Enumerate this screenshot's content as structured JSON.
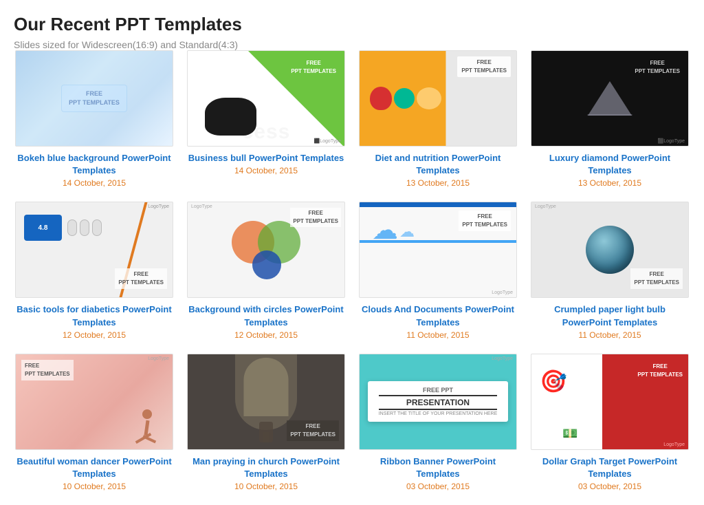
{
  "header": {
    "title": "Our Recent PPT Templates",
    "subtitle": "Slides sized for Widescreen(16:9) and Standard(4:3)"
  },
  "templates": [
    {
      "id": "bokeh-blue",
      "title": "Bokeh blue background PowerPoint Templates",
      "date": "14 October, 2015",
      "thumb_type": "bokeh",
      "badge": "FREE\nPPT TEMPLATES"
    },
    {
      "id": "business-bull",
      "title": "Business bull PowerPoint Templates",
      "date": "14 October, 2015",
      "thumb_type": "bull",
      "badge": "FREE\nPPT TEMPLATES"
    },
    {
      "id": "diet-nutrition",
      "title": "Diet and nutrition PowerPoint Templates",
      "date": "13 October, 2015",
      "thumb_type": "diet",
      "badge": "FREE\nPPT TEMPLATES"
    },
    {
      "id": "luxury-diamond",
      "title": "Luxury diamond PowerPoint Templates",
      "date": "13 October, 2015",
      "thumb_type": "diamond",
      "badge": "FREE\nPPT TEMPLATES"
    },
    {
      "id": "basic-tools-diabetics",
      "title": "Basic tools for diabetics PowerPoint Templates",
      "date": "12 October, 2015",
      "thumb_type": "diabetics",
      "badge": "FREE\nPPT TEMPLATES"
    },
    {
      "id": "background-circles",
      "title": "Background with circles PowerPoint Templates",
      "date": "12 October, 2015",
      "thumb_type": "circles",
      "badge": "FREE\nPPT TEMPLATES"
    },
    {
      "id": "clouds-documents",
      "title": "Clouds And Documents PowerPoint Templates",
      "date": "11 October, 2015",
      "thumb_type": "clouds",
      "badge": "FREE\nPPT TEMPLATES"
    },
    {
      "id": "crumpled-bulb",
      "title": "Crumpled paper light bulb PowerPoint Templates",
      "date": "11 October, 2015",
      "thumb_type": "bulb",
      "badge": "FREE\nPPT TEMPLATES"
    },
    {
      "id": "woman-dancer",
      "title": "Beautiful woman dancer PowerPoint Templates",
      "date": "10 October, 2015",
      "thumb_type": "dancer",
      "badge": "FREE\nPPT TEMPLATES"
    },
    {
      "id": "man-church",
      "title": "Man praying in church PowerPoint Templates",
      "date": "10 October, 2015",
      "thumb_type": "church",
      "badge": "FREE\nPPT TEMPLATES"
    },
    {
      "id": "ribbon-banner",
      "title": "Ribbon Banner PowerPoint Templates",
      "date": "03 October, 2015",
      "thumb_type": "ribbon",
      "badge": "FREE PPT\nPRESENTATION"
    },
    {
      "id": "dollar-target",
      "title": "Dollar Graph Target PowerPoint Templates",
      "date": "03 October, 2015",
      "thumb_type": "dollar",
      "badge": "FREE\nPPT TEMPLATES"
    }
  ]
}
